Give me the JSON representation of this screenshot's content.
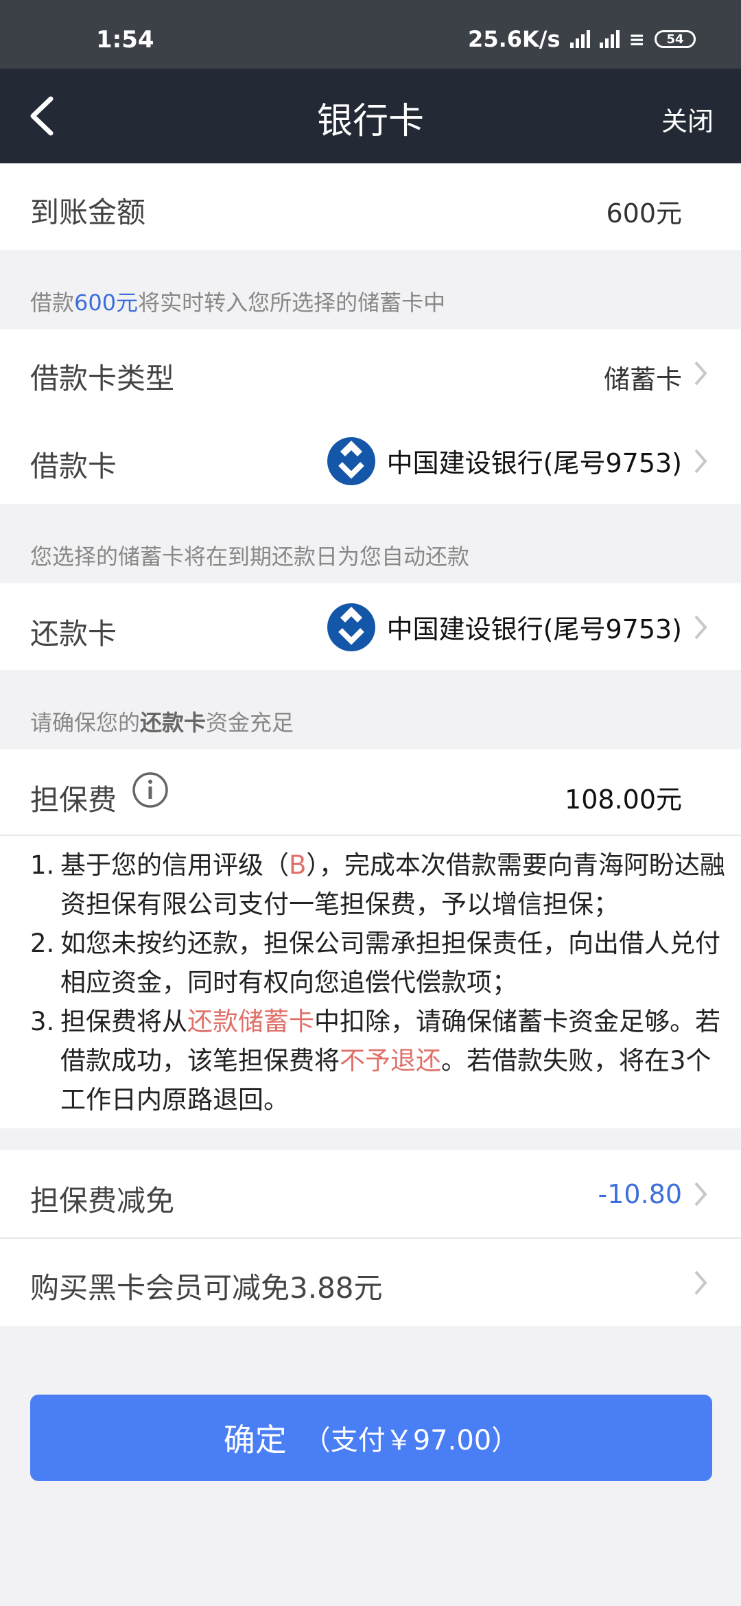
{
  "status_bar": {
    "time": "1:54",
    "network_speed": "25.6K/s",
    "battery": "54"
  },
  "nav": {
    "title": "银行卡",
    "close_label": "关闭"
  },
  "arrival": {
    "label": "到账金额",
    "value": "600元"
  },
  "note1": {
    "prefix": "借款",
    "amount": "600元",
    "suffix": "将实时转入您所选择的储蓄卡中"
  },
  "loan_card_type": {
    "label": "借款卡类型",
    "value": "储蓄卡"
  },
  "loan_card": {
    "label": "借款卡",
    "value": "中国建设银行(尾号9753)"
  },
  "note2": "您选择的储蓄卡将在到期还款日为您自动还款",
  "repay_card": {
    "label": "还款卡",
    "value": "中国建设银行(尾号9753)"
  },
  "note3": {
    "prefix": "请确保您的",
    "bold": "还款卡",
    "suffix": "资金充足"
  },
  "guarantee_fee": {
    "label": "担保费",
    "value": "108.00元"
  },
  "terms": {
    "item1": {
      "num": "1.",
      "a": "基于您的信用评级（",
      "grade": "B",
      "b": "），完成本次借款需要向青海阿盼达融资担保有限公司支付一笔担保费，予以增信担保；"
    },
    "item2": {
      "num": "2.",
      "text": "如您未按约还款，担保公司需承担担保责任，向出借人兑付相应资金，同时有权向您追偿代偿款项；"
    },
    "item3": {
      "num": "3.",
      "a": "担保费将从",
      "red1": "还款储蓄卡",
      "b": "中扣除，请确保储蓄卡资金足够。若借款成功，该笔担保费将",
      "red2": "不予退还",
      "c": "。若借款失败，将在3个工作日内原路退回。"
    }
  },
  "fee_waiver": {
    "label": "担保费减免",
    "value": "-10.80"
  },
  "black_card": {
    "label": "购买黑卡会员可减免3.88元"
  },
  "confirm": {
    "label": "确定",
    "pay": "（支付￥97.00）"
  },
  "colors": {
    "accent_blue": "#4a7ef5",
    "link_blue": "#3c6fd9",
    "warn_red": "#e0706a",
    "nav_bg": "#242936"
  }
}
